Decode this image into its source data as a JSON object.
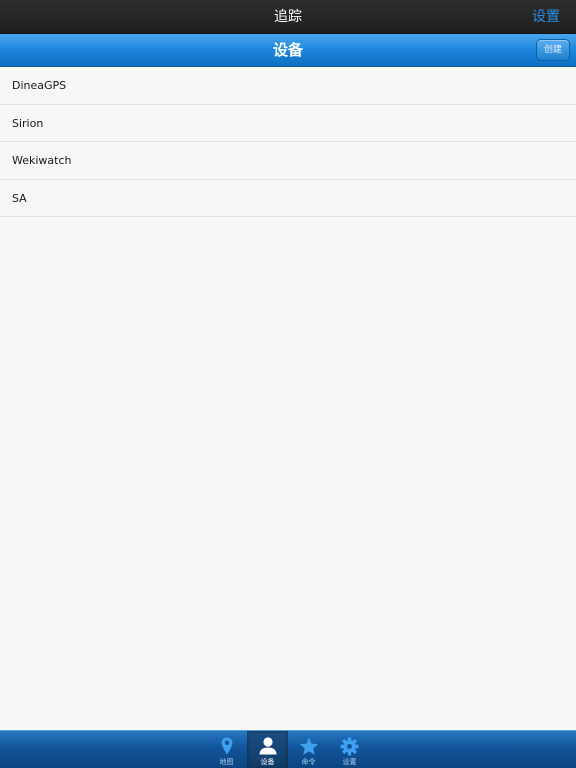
{
  "topbar": {
    "title": "追踪",
    "settings_label": "设置"
  },
  "navbar": {
    "title": "设备",
    "create_label": "创建"
  },
  "devices": [
    {
      "name": "DineaGPS"
    },
    {
      "name": "Sirion"
    },
    {
      "name": "Wekiwatch"
    },
    {
      "name": "SA"
    }
  ],
  "tabs": [
    {
      "id": "map",
      "label": "地图",
      "icon": "map-pin-icon",
      "active": false
    },
    {
      "id": "devices",
      "label": "设备",
      "icon": "person-icon",
      "active": true
    },
    {
      "id": "commands",
      "label": "命令",
      "icon": "star-icon",
      "active": false
    },
    {
      "id": "settings",
      "label": "设置",
      "icon": "gear-icon",
      "active": false
    }
  ],
  "colors": {
    "accent": "#2a8ee6",
    "navbar_blue": "#1c86dc",
    "tabbar_blue": "#12549a",
    "tab_icon": "#3fa0f0",
    "tab_icon_active": "#ffffff"
  }
}
